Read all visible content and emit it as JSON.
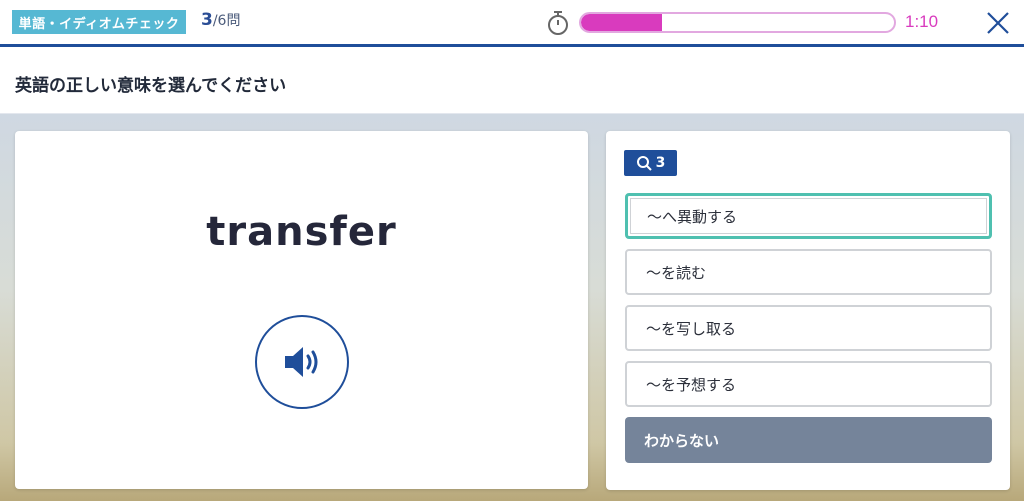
{
  "header": {
    "tag_label": "単語・イディオムチェック",
    "question_current": "3",
    "question_total": "/6問",
    "timer_progress": 0.26,
    "time_remaining": "1:10",
    "accent_color": "#d93bbe"
  },
  "instruction": "英語の正しい意味を選んでください",
  "word_card": {
    "word": "transfer",
    "audio_icon": "speaker-icon"
  },
  "choices_panel": {
    "hint_badge_count": "3",
    "hint_badge_icon": "search-icon",
    "choices": [
      {
        "label": "〜へ異動する",
        "selected": true
      },
      {
        "label": "〜を読む",
        "selected": false
      },
      {
        "label": "〜を写し取る",
        "selected": false
      },
      {
        "label": "〜を予想する",
        "selected": false
      }
    ],
    "dont_know_label": "わからない"
  }
}
